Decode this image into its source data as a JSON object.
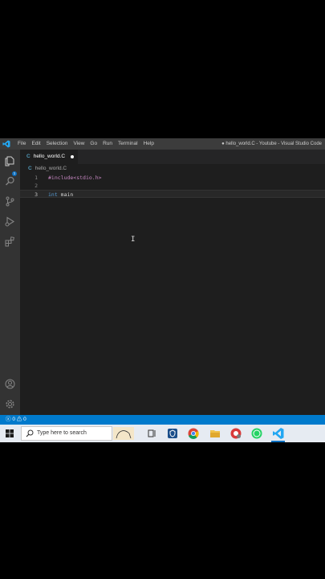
{
  "titlebar": {
    "menu": [
      "File",
      "Edit",
      "Selection",
      "View",
      "Go",
      "Run",
      "Terminal",
      "Help"
    ],
    "window_title": "● hello_world.C - Youtube - Visual Studio Code"
  },
  "activity_bar": {
    "items": [
      "explorer-icon",
      "search-icon",
      "source-control-icon",
      "run-debug-icon",
      "extensions-icon",
      "account-icon",
      "settings-gear-icon"
    ],
    "explorer_badge": "1"
  },
  "tab": {
    "lang_glyph": "C",
    "filename": "hello_world.C"
  },
  "breadcrumb": {
    "lang_glyph": "C",
    "filename": "hello_world.C"
  },
  "editor": {
    "lines": [
      {
        "num": "1",
        "text": "#include<stdio.h>"
      },
      {
        "num": "2",
        "text": ""
      },
      {
        "num": "3",
        "kw": "int",
        "text": " main"
      }
    ]
  },
  "status": {
    "errors": "0",
    "warnings": "0",
    "color": "#007acc"
  },
  "taskbar": {
    "search_placeholder": "Type here to search",
    "apps": [
      "task-view-icon",
      "security-app-icon",
      "chrome-icon",
      "file-explorer-icon",
      "red-app-icon",
      "whatsapp-icon",
      "vscode-icon"
    ]
  }
}
